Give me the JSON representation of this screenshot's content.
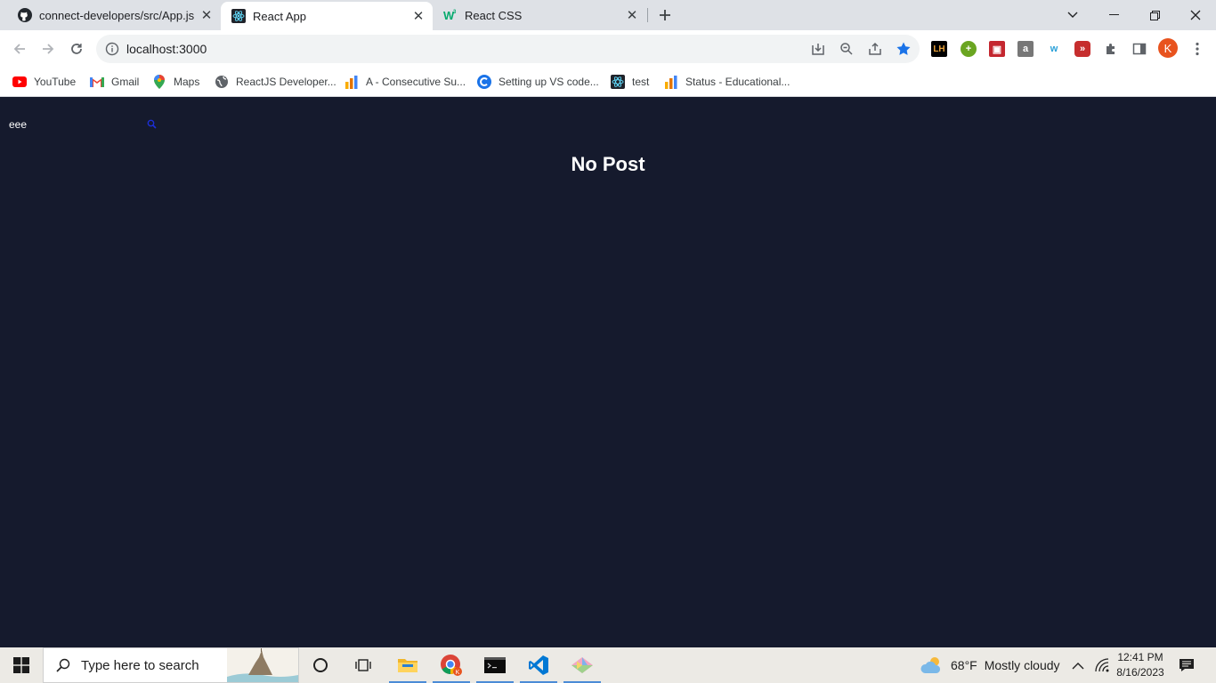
{
  "browser": {
    "tabs": [
      {
        "title": "connect-developers/src/App.js at",
        "icon": "github-icon",
        "active": false
      },
      {
        "title": "React App",
        "icon": "react-icon",
        "active": true
      },
      {
        "title": "React CSS",
        "icon": "w3schools-icon",
        "active": false
      }
    ],
    "address_bar": {
      "url": "localhost:3000"
    },
    "bookmarks": [
      {
        "label": "YouTube",
        "icon": "youtube-icon"
      },
      {
        "label": "Gmail",
        "icon": "gmail-icon"
      },
      {
        "label": "Maps",
        "icon": "maps-icon"
      },
      {
        "label": "ReactJS Developer...",
        "icon": "globe-icon"
      },
      {
        "label": "A - Consecutive Su...",
        "icon": "bar-chart-icon"
      },
      {
        "label": "Setting up VS code...",
        "icon": "c-logo-icon"
      },
      {
        "label": "test",
        "icon": "react-icon"
      },
      {
        "label": "Status - Educational...",
        "icon": "bar-chart-icon"
      }
    ],
    "profile_initial": "K",
    "colors": {
      "accent": "#1a73e8",
      "profile": "#e8531e"
    }
  },
  "app": {
    "search": {
      "value": "eee"
    },
    "message": "No Post",
    "colors": {
      "background": "#151a2d",
      "text": "#ffffff"
    }
  },
  "taskbar": {
    "search_placeholder": "Type here to search",
    "weather": {
      "temperature": "68°F",
      "condition": "Mostly cloudy"
    },
    "clock": {
      "time": "12:41 PM",
      "date": "8/16/2023"
    }
  }
}
